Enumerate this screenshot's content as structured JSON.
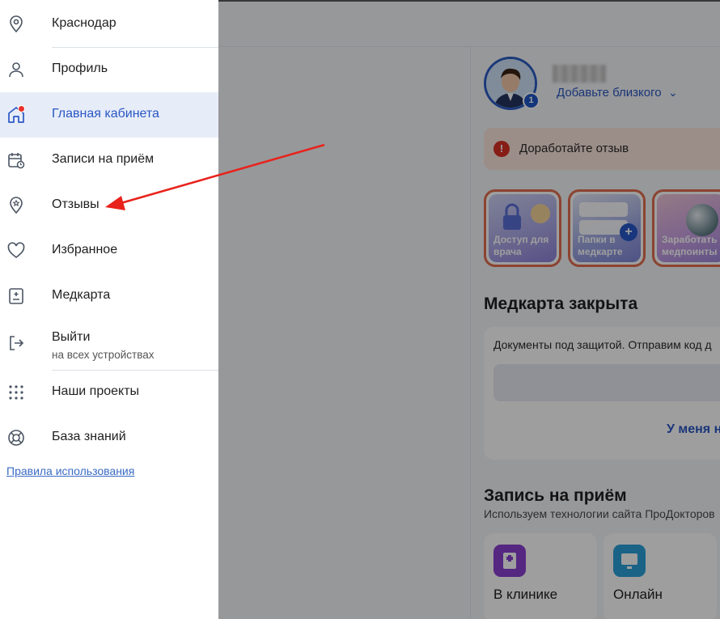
{
  "menu": {
    "city": "Краснодар",
    "items": [
      {
        "label": "Профиль"
      },
      {
        "label": "Главная кабинета"
      },
      {
        "label": "Записи на приём"
      },
      {
        "label": "Отзывы"
      },
      {
        "label": "Избранное"
      },
      {
        "label": "Медкарта"
      },
      {
        "label": "Выйти",
        "sub": "на всех устройствах"
      },
      {
        "label": "Наши проекты"
      },
      {
        "label": "База знаний"
      }
    ],
    "rules_link": "Правила использования",
    "active_item": "Главная кабинета"
  },
  "background": {
    "profile": {
      "add_relative": "Добавьте близкого",
      "badge_count": "1"
    },
    "alert": "Доработайте отзыв",
    "stories": [
      {
        "label": "Доступ для\nврача"
      },
      {
        "label": "Папки в\nмедкарте"
      },
      {
        "label": "Заработать\nмедпоинты"
      }
    ],
    "medcard": {
      "title": "Медкарта закрыта",
      "text": "Документы под защитой. Отправим код д",
      "link": "У меня н"
    },
    "appointment": {
      "title": "Запись на приём",
      "subtitle": "Используем технологии сайта ПроДокторов",
      "options": [
        "В клинике",
        "Онлайн"
      ]
    }
  },
  "colors": {
    "accent": "#2a57c5",
    "active_bg": "#e7edf8",
    "alert_bg": "#fbe5dd",
    "annotation_arrow": "#e8221b"
  }
}
